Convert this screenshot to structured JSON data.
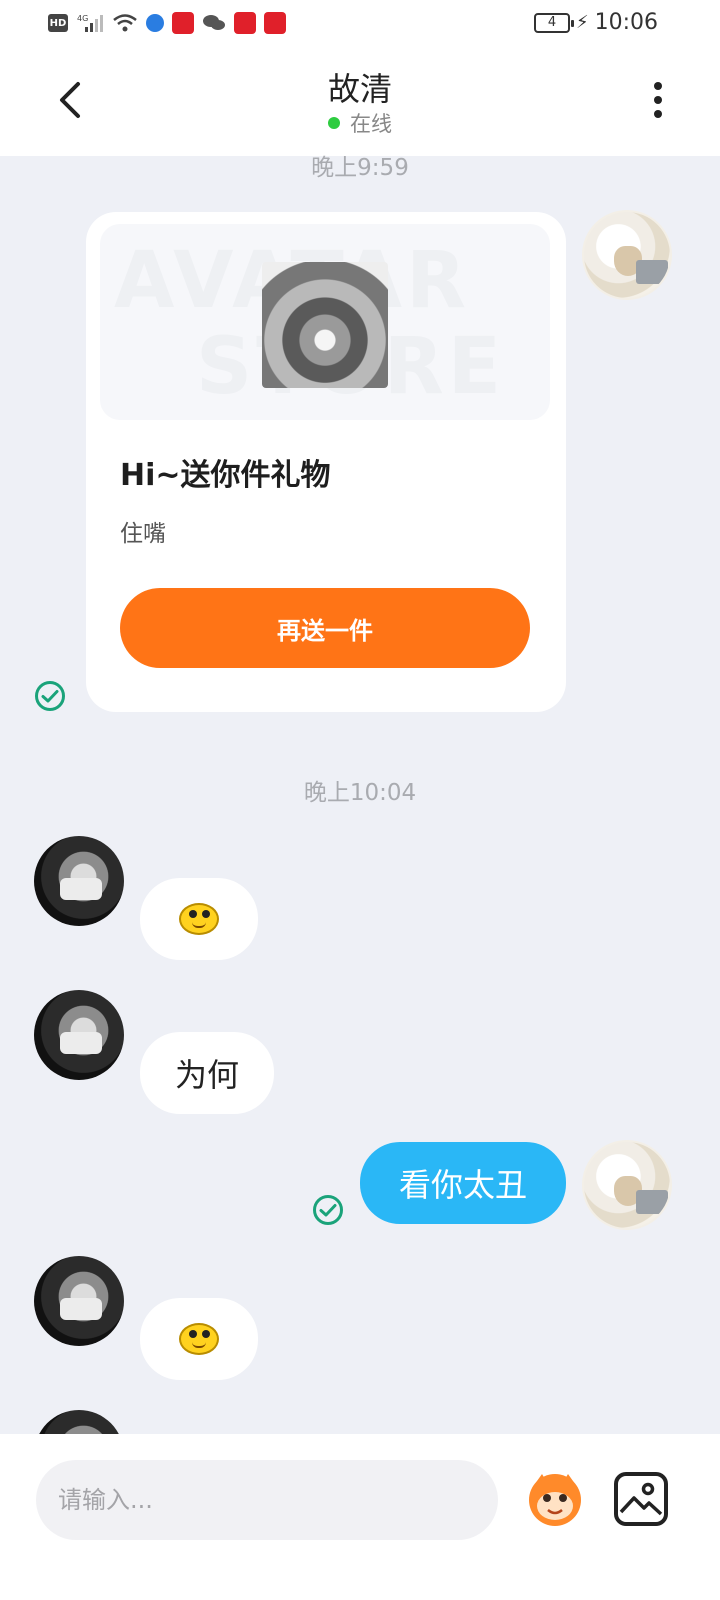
{
  "status_bar": {
    "hd": "HD",
    "network": "4G",
    "battery": "4",
    "time": "10:06"
  },
  "header": {
    "title": "故清",
    "status": "在线",
    "status_color": "#2ecc40"
  },
  "messages": {
    "timestamp_1": "晚上9:59",
    "gift_card": {
      "watermark_line1": "AVATAR",
      "watermark_line2": "STORE",
      "title": "Hi~送你件礼物",
      "subtitle": "住嘴",
      "button_label": "再送一件",
      "button_color": "#ff7416"
    },
    "timestamp_2": "晚上10:04",
    "msg_2_text": "为何",
    "msg_3_text": "看你太丑",
    "bubble_me_color": "#2ab7f6"
  },
  "input": {
    "placeholder": "请输入..."
  },
  "icons": {
    "back": "back-arrow-icon",
    "more": "more-vertical-icon",
    "sent": "check-circle-icon",
    "sticker": "sticker-face-icon",
    "image": "image-gallery-icon"
  }
}
